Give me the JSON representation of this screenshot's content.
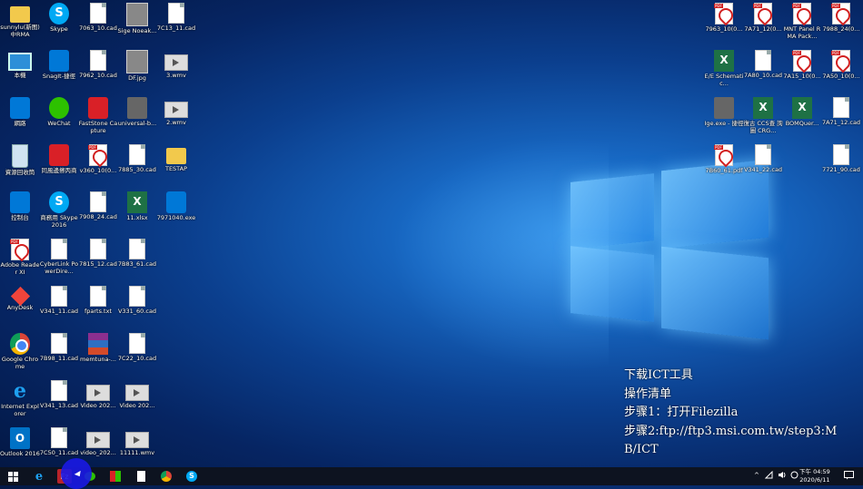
{
  "desktop": {
    "icons": [
      {
        "label": "sunnylu(新图)中RMA",
        "x": 0,
        "y": 0,
        "type": "folder"
      },
      {
        "label": "Skype",
        "x": 1,
        "y": 0,
        "type": "cyan"
      },
      {
        "label": "7063_10.cad",
        "x": 2,
        "y": 0,
        "type": "file"
      },
      {
        "label": "Sige Noeak...",
        "x": 3,
        "y": 0,
        "type": "img"
      },
      {
        "label": "7C13_11.cad",
        "x": 4,
        "y": 0,
        "type": "file"
      },
      {
        "label": "本機",
        "x": 0,
        "y": 1,
        "type": "pc"
      },
      {
        "label": "SnagIt-捷徑",
        "x": 1,
        "y": 1,
        "type": "blue"
      },
      {
        "label": "7962_10.cad",
        "x": 2,
        "y": 1,
        "type": "file"
      },
      {
        "label": "DF.jpg",
        "x": 3,
        "y": 1,
        "type": "img"
      },
      {
        "label": "3.wmv",
        "x": 4,
        "y": 1,
        "type": "video"
      },
      {
        "label": "網路",
        "x": 0,
        "y": 2,
        "type": "blue"
      },
      {
        "label": "WeChat",
        "x": 1,
        "y": 2,
        "type": "green"
      },
      {
        "label": "FastStone Capture",
        "x": 2,
        "y": 2,
        "type": "red"
      },
      {
        "label": "universal-b...",
        "x": 3,
        "y": 2,
        "type": "app"
      },
      {
        "label": "2.wmv",
        "x": 4,
        "y": 2,
        "type": "video"
      },
      {
        "label": "資源回收筒",
        "x": 0,
        "y": 3,
        "type": "bin"
      },
      {
        "label": "同風邊擦丙商",
        "x": 1,
        "y": 3,
        "type": "red"
      },
      {
        "label": "v360_10(0...",
        "x": 2,
        "y": 3,
        "type": "pdf"
      },
      {
        "label": "7885_30.cad",
        "x": 3,
        "y": 3,
        "type": "file"
      },
      {
        "label": "TESTAP",
        "x": 4,
        "y": 3,
        "type": "folder"
      },
      {
        "label": "控制台",
        "x": 0,
        "y": 4,
        "type": "blue"
      },
      {
        "label": "商務用 Skype 2016",
        "x": 1,
        "y": 4,
        "type": "cyan"
      },
      {
        "label": "7908_24.cad",
        "x": 2,
        "y": 4,
        "type": "file"
      },
      {
        "label": "11.xlsx",
        "x": 3,
        "y": 4,
        "type": "excel"
      },
      {
        "label": "7971040.exe",
        "x": 4,
        "y": 4,
        "type": "blue"
      },
      {
        "label": "Adobe Reader XI",
        "x": 0,
        "y": 5,
        "type": "pdf"
      },
      {
        "label": "CyberLink PowerDire...",
        "x": 1,
        "y": 5,
        "type": "file"
      },
      {
        "label": "7815_12.cad",
        "x": 2,
        "y": 5,
        "type": "file"
      },
      {
        "label": "7B83_61.cad",
        "x": 3,
        "y": 5,
        "type": "file"
      },
      {
        "label": "AnyDesk",
        "x": 0,
        "y": 6,
        "type": "anydesk"
      },
      {
        "label": "V341_11.cad",
        "x": 1,
        "y": 6,
        "type": "file"
      },
      {
        "label": "fparts.txt",
        "x": 2,
        "y": 6,
        "type": "file"
      },
      {
        "label": "V331_60.cad",
        "x": 3,
        "y": 6,
        "type": "file"
      },
      {
        "label": "Google Chrome",
        "x": 0,
        "y": 7,
        "type": "chrome"
      },
      {
        "label": "7B98_11.cad",
        "x": 1,
        "y": 7,
        "type": "file"
      },
      {
        "label": "memtuna-...",
        "x": 2,
        "y": 7,
        "type": "winrar"
      },
      {
        "label": "7C22_10.cad",
        "x": 3,
        "y": 7,
        "type": "file"
      },
      {
        "label": "Internet Explorer",
        "x": 0,
        "y": 8,
        "type": "ie"
      },
      {
        "label": "V341_13.cad",
        "x": 1,
        "y": 8,
        "type": "file"
      },
      {
        "label": "Video 202...",
        "x": 2,
        "y": 8,
        "type": "video"
      },
      {
        "label": "Video 202...",
        "x": 3,
        "y": 8,
        "type": "video"
      },
      {
        "label": "Outlook 2016",
        "x": 0,
        "y": 9,
        "type": "outlook"
      },
      {
        "label": "7C50_11.cad",
        "x": 1,
        "y": 9,
        "type": "file"
      },
      {
        "label": "video_202...",
        "x": 2,
        "y": 9,
        "type": "video"
      },
      {
        "label": "11111.wmv",
        "x": 3,
        "y": 9,
        "type": "video"
      }
    ],
    "right_icons": [
      {
        "label": "7963_10(0...",
        "x": 0,
        "y": 0,
        "type": "pdf"
      },
      {
        "label": "7A71_12(0...",
        "x": 1,
        "y": 0,
        "type": "pdf"
      },
      {
        "label": "MNT Panel RMA Pack...",
        "x": 2,
        "y": 0,
        "type": "pdf"
      },
      {
        "label": "7988_24(0...",
        "x": 3,
        "y": 0,
        "type": "pdf"
      },
      {
        "label": "E/E Schematic...",
        "x": 0,
        "y": 1,
        "type": "excel"
      },
      {
        "label": "7A80_10.cad",
        "x": 1,
        "y": 1,
        "type": "file"
      },
      {
        "label": "7A15_10(0...",
        "x": 2,
        "y": 1,
        "type": "pdf"
      },
      {
        "label": "7A50_10(0...",
        "x": 3,
        "y": 1,
        "type": "pdf"
      },
      {
        "label": "Ige.exe - 捷徑",
        "x": 0,
        "y": 2,
        "type": "app"
      },
      {
        "label": "復古 CCS查 詢圖 CRG...",
        "x": 1,
        "y": 2,
        "type": "excel"
      },
      {
        "label": "BOMQuer...",
        "x": 2,
        "y": 2,
        "type": "excel"
      },
      {
        "label": "7A71_12.cad",
        "x": 3,
        "y": 2,
        "type": "file"
      },
      {
        "label": "7B60_61.pdf",
        "x": 0,
        "y": 3,
        "type": "pdf"
      },
      {
        "label": "V341_22.cad",
        "x": 1,
        "y": 3,
        "type": "file"
      },
      {
        "label": "7721_90.cad",
        "x": 3,
        "y": 3,
        "type": "file"
      }
    ]
  },
  "note": {
    "line1": "下载ICT工具",
    "line2": "操作清单",
    "line3": "步骤1：打开Filezilla",
    "line4": "步骤2:ftp://ftp3.msi.com.tw/step3:M",
    "line5": "B/ICT"
  },
  "taskbar": {
    "start_icon": "windows-start-icon",
    "apps": [
      "internet-explorer-icon",
      "filezilla-icon",
      "wechat-icon",
      "faststone-icon",
      "file-icon",
      "chrome-icon",
      "skype-icon"
    ],
    "clock_time": "下午 04:59",
    "clock_date": "2020/6/11",
    "tray_chevron": "^"
  }
}
